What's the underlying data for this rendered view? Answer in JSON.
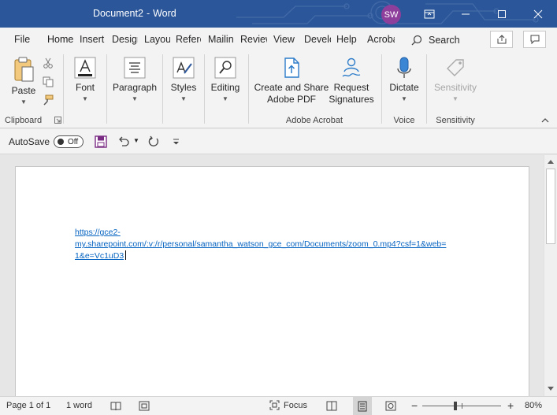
{
  "window": {
    "doc_name": "Document2",
    "app_name": "Word",
    "separator": "-",
    "user_initials": "SW"
  },
  "tabs": [
    {
      "label": "File"
    },
    {
      "label": "Home"
    },
    {
      "label": "Insert"
    },
    {
      "label": "Design"
    },
    {
      "label": "Layout"
    },
    {
      "label": "References"
    },
    {
      "label": "Mailings"
    },
    {
      "label": "Review"
    },
    {
      "label": "View"
    },
    {
      "label": "Developer"
    },
    {
      "label": "Help"
    },
    {
      "label": "Acrobat"
    }
  ],
  "search": {
    "label": "Search"
  },
  "ribbon": {
    "clipboard": {
      "paste": "Paste",
      "group": "Clipboard"
    },
    "font": {
      "label": "Font"
    },
    "paragraph": {
      "label": "Paragraph"
    },
    "styles": {
      "label": "Styles"
    },
    "editing": {
      "label": "Editing"
    },
    "acrobat": {
      "create_line1": "Create and Share",
      "create_line2": "Adobe PDF",
      "request_line1": "Request",
      "request_line2": "Signatures",
      "group": "Adobe Acrobat"
    },
    "voice": {
      "dictate": "Dictate",
      "group": "Voice"
    },
    "sensitivity": {
      "label": "Sensitivity",
      "group": "Sensitivity"
    }
  },
  "qat": {
    "autosave": "AutoSave",
    "toggle": "Off"
  },
  "document": {
    "link_line1": "https://gce2-",
    "link_line2": "my.sharepoint.com/:v:/r/personal/samantha_watson_gce_com/Documents/zoom_0.mp4?csf=1&web=",
    "link_line3": "1&e=Vc1uD3"
  },
  "status": {
    "page": "Page 1 of 1",
    "words": "1 word",
    "focus": "Focus",
    "zoom": "80%"
  },
  "colors": {
    "accent": "#2b579a",
    "link": "#0563c1",
    "avatar": "#8e3f9c"
  }
}
